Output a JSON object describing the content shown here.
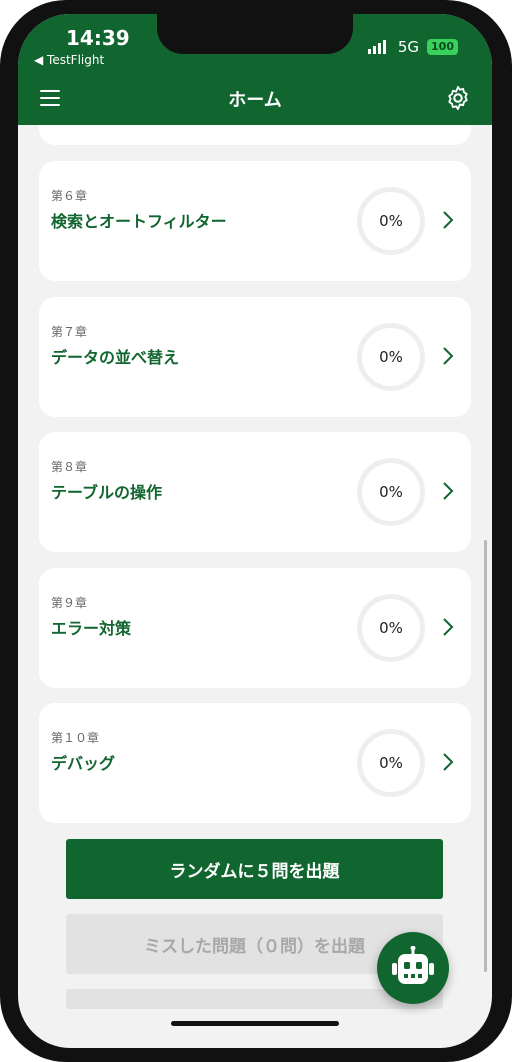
{
  "status_bar": {
    "time": "14:39",
    "back_app": "◀ TestFlight",
    "network": "5G",
    "battery": "100"
  },
  "header": {
    "title": "ホーム"
  },
  "chapters": [
    {
      "label": "第６章",
      "title": "検索とオートフィルター",
      "progress": "0%"
    },
    {
      "label": "第７章",
      "title": "データの並べ替え",
      "progress": "0%"
    },
    {
      "label": "第８章",
      "title": "テーブルの操作",
      "progress": "0%"
    },
    {
      "label": "第９章",
      "title": "エラー対策",
      "progress": "0%"
    },
    {
      "label": "第１０章",
      "title": "デバッグ",
      "progress": "0%"
    }
  ],
  "actions": {
    "random_label": "ランダムに５問を出題",
    "missed_label": "ミスした問題（０問）を出題"
  },
  "colors": {
    "brand_green": "#11652f",
    "background": "#f2f2f2",
    "disabled_button": "#e2e2e2"
  },
  "icons": [
    "menu-icon",
    "gear-icon",
    "chevron-right-icon",
    "robot-icon"
  ]
}
